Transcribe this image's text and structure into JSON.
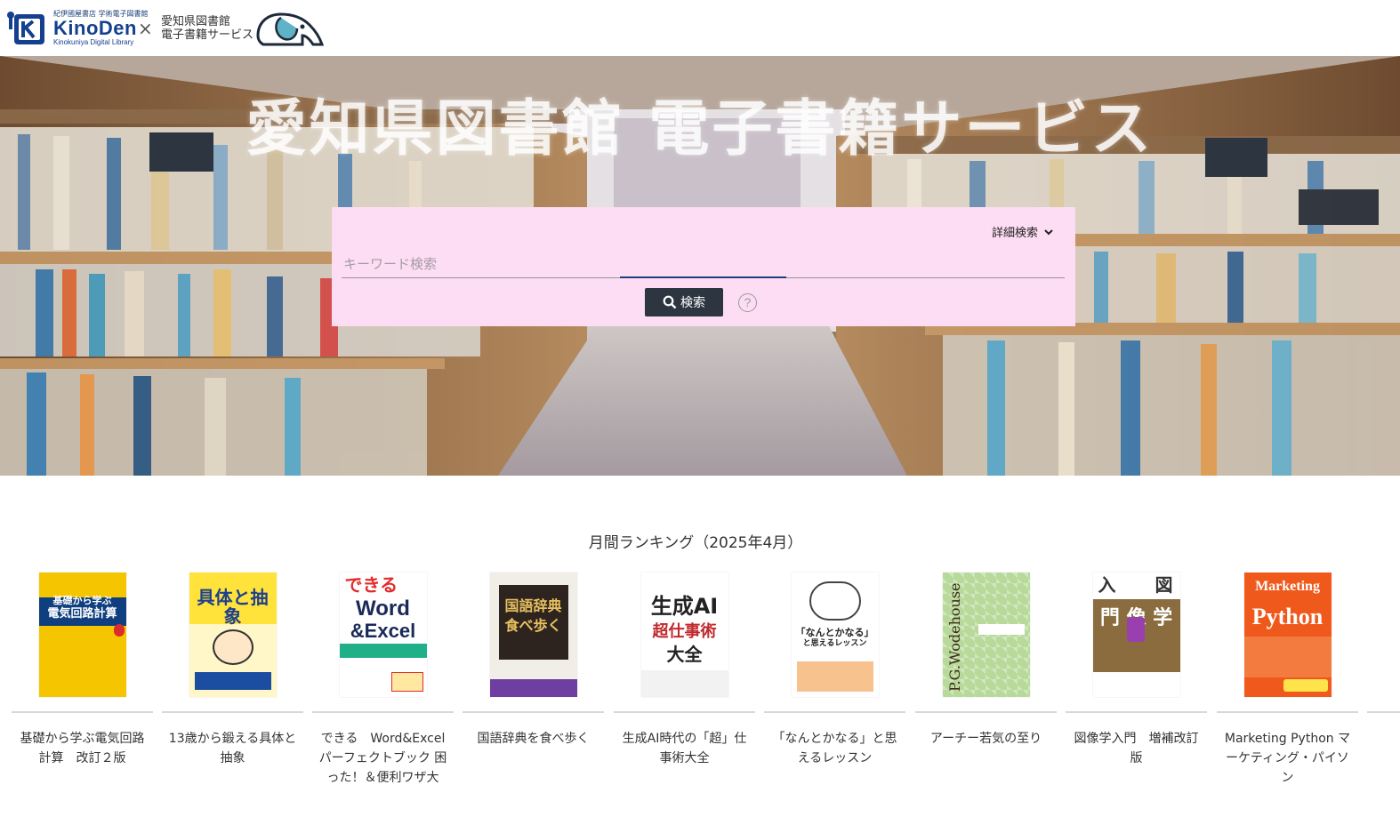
{
  "header": {
    "kinoden_small": "紀伊國屋書店 学術電子図書館",
    "kinoden_name": "KinoDen",
    "kinoden_sub": "Kinokuniya Digital Library",
    "cross": "×",
    "library_line1": "愛知県図書館",
    "library_line2": "電子書籍サービス"
  },
  "hero": {
    "title": "愛知県図書館 電子書籍サービス"
  },
  "search": {
    "advanced_label": "詳細検索",
    "placeholder": "キーワード検索",
    "value": "",
    "button_label": "検索",
    "help": "?"
  },
  "ranking": {
    "title": "月間ランキング（2025年4月）",
    "books": [
      {
        "title": "基礎から学ぶ電気回路計算　改訂２版",
        "cover_text": "基礎から学ぶ\n電気回路計算"
      },
      {
        "title": "13歳から鍛える具体と抽象",
        "cover_text": "具体と抽象"
      },
      {
        "title": "できる　Word&Excel パーフェクトブック 困った！＆便利ワザ大",
        "cover_text": "できる\nWord\n&Excel"
      },
      {
        "title": "国語辞典を食べ歩く",
        "cover_text": "国語辞典を\n食べ歩く"
      },
      {
        "title": "生成AI時代の「超」仕事術大全",
        "cover_text": "生成AI\n超仕事術\n大全"
      },
      {
        "title": "「なんとかなる」と思えるレッスン",
        "cover_text": "「なんとかなる」\nと思えるレッスン"
      },
      {
        "title": "アーチー若気の至り",
        "cover_text": "P.G.Wodehouse"
      },
      {
        "title": "図像学入門　増補改訂版",
        "cover_text": "入門 図像学"
      },
      {
        "title": "Marketing Python マーケティング・パイソン",
        "cover_text": "Marketing\nPython"
      }
    ]
  }
}
